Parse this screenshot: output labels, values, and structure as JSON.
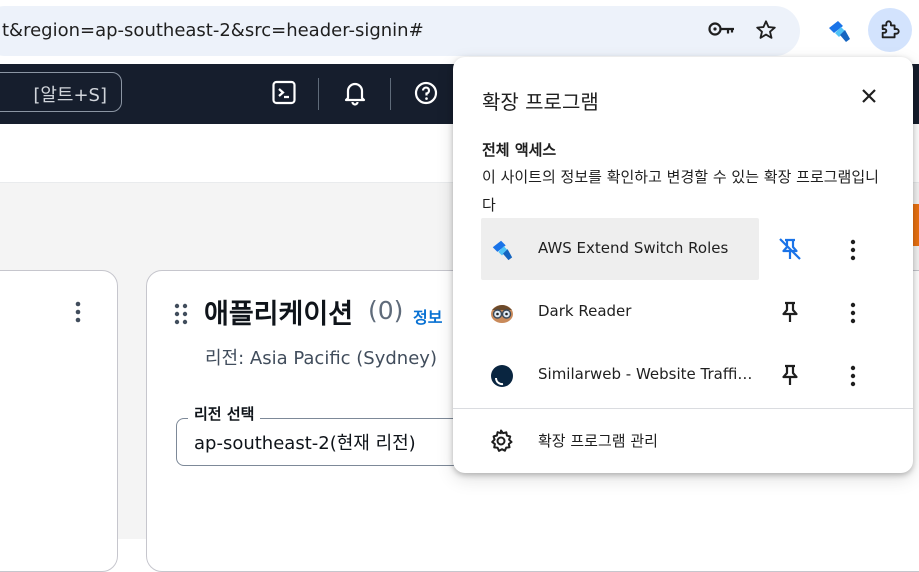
{
  "browser": {
    "url_visible": "t&region=ap-southeast-2&src=header-signin#",
    "icons": [
      "key-icon",
      "star-icon",
      "aws-extend-switch-roles-icon",
      "puzzle-icon"
    ]
  },
  "aws_header": {
    "search_shortcut": "[알트+S]",
    "icons": [
      "cloudshell-icon",
      "bell-icon",
      "help-icon"
    ]
  },
  "main": {
    "app_title": "애플리케이션",
    "app_count": "(0)",
    "info_link": "정보",
    "region_line": "리전: Asia Pacific (Sydney)",
    "region_select_label": "리전 선택",
    "region_select_value": "ap-southeast-2(현재 리전)"
  },
  "extensions_popup": {
    "title": "확장 프로그램",
    "full_access_heading": "전체 액세스",
    "full_access_description": "이 사이트의 정보를 확인하고 변경할 수 있는 확장 프로그램입니다",
    "items": [
      {
        "name": "AWS Extend Switch Roles",
        "icon": "aws-extend-switch-roles-icon",
        "pinned": true,
        "highlighted": true
      },
      {
        "name": "Dark Reader",
        "icon": "dark-reader-icon",
        "pinned": false
      },
      {
        "name": "Similarweb - Website Traffic & SEO Checker",
        "icon": "similarweb-icon",
        "pinned": false
      }
    ],
    "manage_label": "확장 프로그램 관리"
  },
  "colors": {
    "aws_header_bg": "#161e2d",
    "omnibox_bg": "#edf2fa",
    "puzzle_active_bg": "#d3e3fd",
    "link_blue": "#0972d3",
    "pin_active_blue": "#1a73e8",
    "aws_orange": "#ec7211"
  }
}
